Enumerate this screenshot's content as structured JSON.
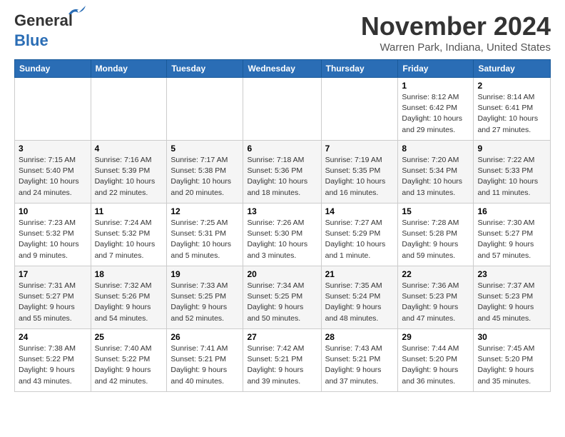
{
  "header": {
    "logo_line1": "General",
    "logo_line2": "Blue",
    "month": "November 2024",
    "location": "Warren Park, Indiana, United States"
  },
  "days_of_week": [
    "Sunday",
    "Monday",
    "Tuesday",
    "Wednesday",
    "Thursday",
    "Friday",
    "Saturday"
  ],
  "weeks": [
    [
      {
        "day": "",
        "info": ""
      },
      {
        "day": "",
        "info": ""
      },
      {
        "day": "",
        "info": ""
      },
      {
        "day": "",
        "info": ""
      },
      {
        "day": "",
        "info": ""
      },
      {
        "day": "1",
        "info": "Sunrise: 8:12 AM\nSunset: 6:42 PM\nDaylight: 10 hours\nand 29 minutes."
      },
      {
        "day": "2",
        "info": "Sunrise: 8:14 AM\nSunset: 6:41 PM\nDaylight: 10 hours\nand 27 minutes."
      }
    ],
    [
      {
        "day": "3",
        "info": "Sunrise: 7:15 AM\nSunset: 5:40 PM\nDaylight: 10 hours\nand 24 minutes."
      },
      {
        "day": "4",
        "info": "Sunrise: 7:16 AM\nSunset: 5:39 PM\nDaylight: 10 hours\nand 22 minutes."
      },
      {
        "day": "5",
        "info": "Sunrise: 7:17 AM\nSunset: 5:38 PM\nDaylight: 10 hours\nand 20 minutes."
      },
      {
        "day": "6",
        "info": "Sunrise: 7:18 AM\nSunset: 5:36 PM\nDaylight: 10 hours\nand 18 minutes."
      },
      {
        "day": "7",
        "info": "Sunrise: 7:19 AM\nSunset: 5:35 PM\nDaylight: 10 hours\nand 16 minutes."
      },
      {
        "day": "8",
        "info": "Sunrise: 7:20 AM\nSunset: 5:34 PM\nDaylight: 10 hours\nand 13 minutes."
      },
      {
        "day": "9",
        "info": "Sunrise: 7:22 AM\nSunset: 5:33 PM\nDaylight: 10 hours\nand 11 minutes."
      }
    ],
    [
      {
        "day": "10",
        "info": "Sunrise: 7:23 AM\nSunset: 5:32 PM\nDaylight: 10 hours\nand 9 minutes."
      },
      {
        "day": "11",
        "info": "Sunrise: 7:24 AM\nSunset: 5:32 PM\nDaylight: 10 hours\nand 7 minutes."
      },
      {
        "day": "12",
        "info": "Sunrise: 7:25 AM\nSunset: 5:31 PM\nDaylight: 10 hours\nand 5 minutes."
      },
      {
        "day": "13",
        "info": "Sunrise: 7:26 AM\nSunset: 5:30 PM\nDaylight: 10 hours\nand 3 minutes."
      },
      {
        "day": "14",
        "info": "Sunrise: 7:27 AM\nSunset: 5:29 PM\nDaylight: 10 hours\nand 1 minute."
      },
      {
        "day": "15",
        "info": "Sunrise: 7:28 AM\nSunset: 5:28 PM\nDaylight: 9 hours\nand 59 minutes."
      },
      {
        "day": "16",
        "info": "Sunrise: 7:30 AM\nSunset: 5:27 PM\nDaylight: 9 hours\nand 57 minutes."
      }
    ],
    [
      {
        "day": "17",
        "info": "Sunrise: 7:31 AM\nSunset: 5:27 PM\nDaylight: 9 hours\nand 55 minutes."
      },
      {
        "day": "18",
        "info": "Sunrise: 7:32 AM\nSunset: 5:26 PM\nDaylight: 9 hours\nand 54 minutes."
      },
      {
        "day": "19",
        "info": "Sunrise: 7:33 AM\nSunset: 5:25 PM\nDaylight: 9 hours\nand 52 minutes."
      },
      {
        "day": "20",
        "info": "Sunrise: 7:34 AM\nSunset: 5:25 PM\nDaylight: 9 hours\nand 50 minutes."
      },
      {
        "day": "21",
        "info": "Sunrise: 7:35 AM\nSunset: 5:24 PM\nDaylight: 9 hours\nand 48 minutes."
      },
      {
        "day": "22",
        "info": "Sunrise: 7:36 AM\nSunset: 5:23 PM\nDaylight: 9 hours\nand 47 minutes."
      },
      {
        "day": "23",
        "info": "Sunrise: 7:37 AM\nSunset: 5:23 PM\nDaylight: 9 hours\nand 45 minutes."
      }
    ],
    [
      {
        "day": "24",
        "info": "Sunrise: 7:38 AM\nSunset: 5:22 PM\nDaylight: 9 hours\nand 43 minutes."
      },
      {
        "day": "25",
        "info": "Sunrise: 7:40 AM\nSunset: 5:22 PM\nDaylight: 9 hours\nand 42 minutes."
      },
      {
        "day": "26",
        "info": "Sunrise: 7:41 AM\nSunset: 5:21 PM\nDaylight: 9 hours\nand 40 minutes."
      },
      {
        "day": "27",
        "info": "Sunrise: 7:42 AM\nSunset: 5:21 PM\nDaylight: 9 hours\nand 39 minutes."
      },
      {
        "day": "28",
        "info": "Sunrise: 7:43 AM\nSunset: 5:21 PM\nDaylight: 9 hours\nand 37 minutes."
      },
      {
        "day": "29",
        "info": "Sunrise: 7:44 AM\nSunset: 5:20 PM\nDaylight: 9 hours\nand 36 minutes."
      },
      {
        "day": "30",
        "info": "Sunrise: 7:45 AM\nSunset: 5:20 PM\nDaylight: 9 hours\nand 35 minutes."
      }
    ]
  ]
}
